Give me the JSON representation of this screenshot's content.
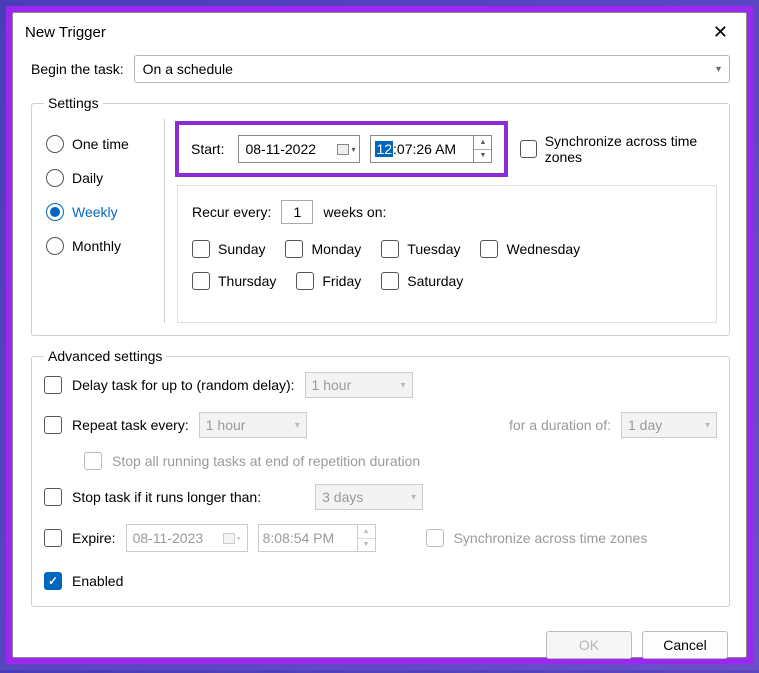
{
  "title": "New Trigger",
  "begin": {
    "label": "Begin the task:",
    "value": "On a schedule"
  },
  "settings": {
    "legend": "Settings",
    "freq": {
      "one_time": "One time",
      "daily": "Daily",
      "weekly": "Weekly",
      "monthly": "Monthly"
    },
    "start": {
      "label": "Start:",
      "date": "08-11-2022",
      "time_sel": "12",
      "time_rest": ":07:26 AM"
    },
    "sync": "Synchronize across time zones",
    "recur": {
      "label_a": "Recur every:",
      "value": "1",
      "label_b": "weeks on:",
      "days": {
        "sunday": "Sunday",
        "monday": "Monday",
        "tuesday": "Tuesday",
        "wednesday": "Wednesday",
        "thursday": "Thursday",
        "friday": "Friday",
        "saturday": "Saturday"
      }
    }
  },
  "advanced": {
    "legend": "Advanced settings",
    "delay": {
      "label": "Delay task for up to (random delay):",
      "value": "1 hour"
    },
    "repeat": {
      "label": "Repeat task every:",
      "value": "1 hour",
      "duration_label": "for a duration of:",
      "duration_value": "1 day"
    },
    "stop_running": "Stop all running tasks at end of repetition duration",
    "stop_longer": {
      "label": "Stop task if it runs longer than:",
      "value": "3 days"
    },
    "expire": {
      "label": "Expire:",
      "date": "08-11-2023",
      "time": "8:08:54 PM",
      "sync": "Synchronize across time zones"
    },
    "enabled": "Enabled"
  },
  "buttons": {
    "ok": "OK",
    "cancel": "Cancel"
  }
}
